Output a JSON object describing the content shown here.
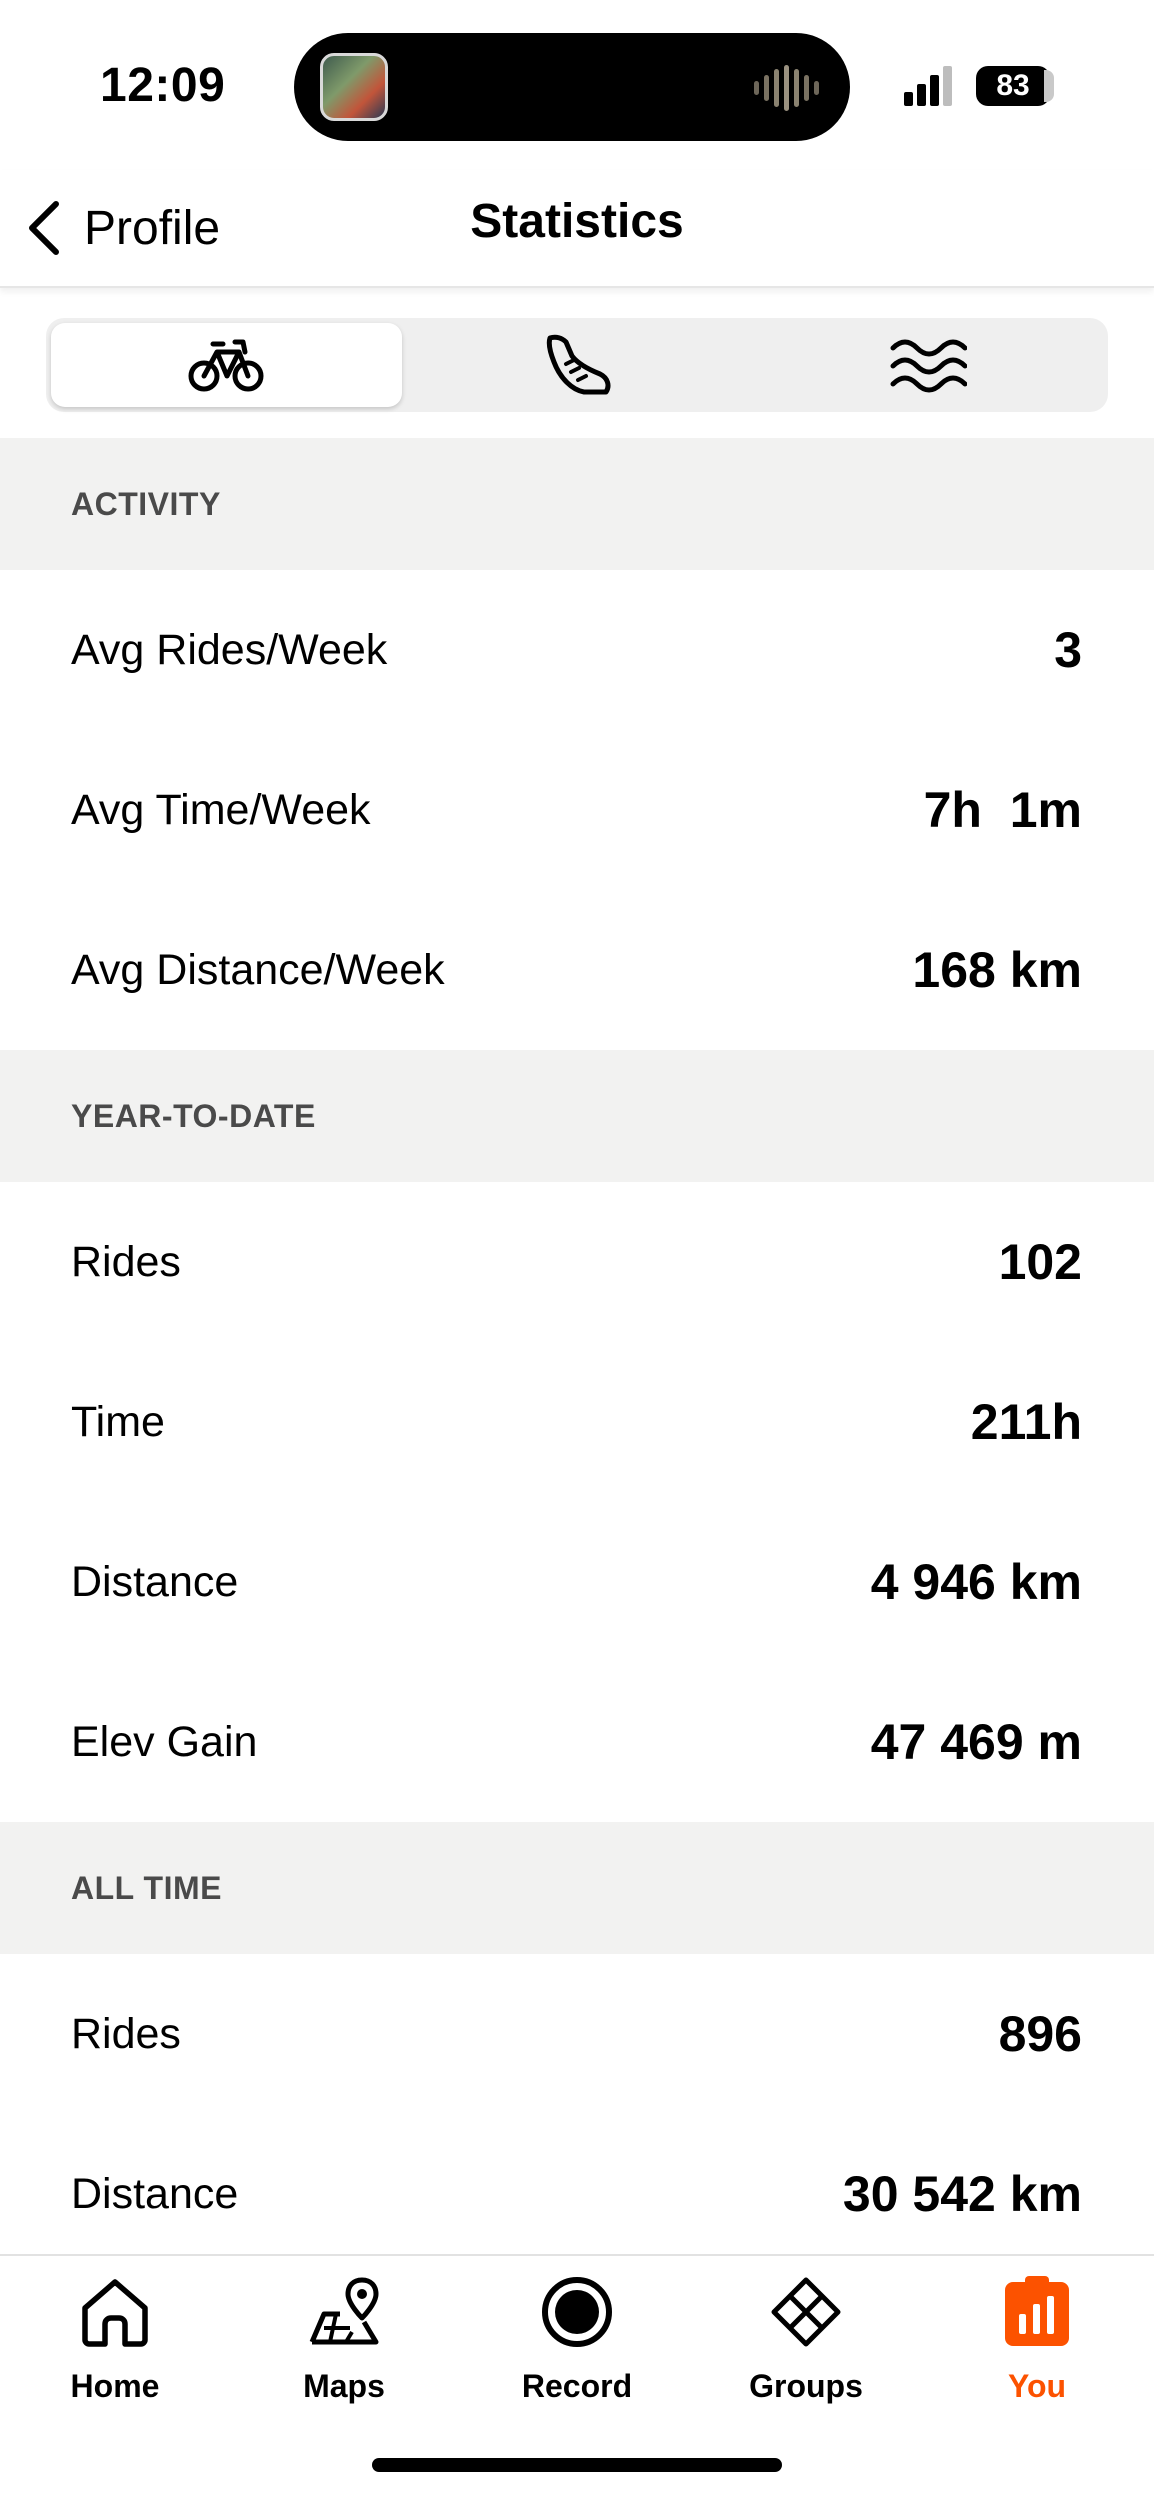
{
  "status_bar": {
    "time": "12:09",
    "battery": "83"
  },
  "header": {
    "back_label": "Profile",
    "title": "Statistics"
  },
  "sport_tabs": [
    {
      "icon": "bike-icon",
      "active": true
    },
    {
      "icon": "run-shoe-icon",
      "active": false
    },
    {
      "icon": "swim-waves-icon",
      "active": false
    }
  ],
  "sections": {
    "activity": {
      "title": "ACTIVITY",
      "rows": [
        {
          "label": "Avg Rides/Week",
          "value": "3"
        },
        {
          "label": "Avg Time/Week",
          "value": "7h  1m"
        },
        {
          "label": "Avg Distance/Week",
          "value": "168 km"
        }
      ]
    },
    "ytd": {
      "title": "YEAR-TO-DATE",
      "rows": [
        {
          "label": "Rides",
          "value": "102"
        },
        {
          "label": "Time",
          "value": "211h"
        },
        {
          "label": "Distance",
          "value": "4 946 km"
        },
        {
          "label": "Elev Gain",
          "value": "47 469 m"
        }
      ]
    },
    "all_time": {
      "title": "ALL TIME",
      "rows": [
        {
          "label": "Rides",
          "value": "896"
        },
        {
          "label": "Distance",
          "value": "30 542 km"
        }
      ]
    }
  },
  "tab_bar": {
    "items": [
      {
        "label": "Home",
        "icon": "home-icon"
      },
      {
        "label": "Maps",
        "icon": "maps-icon"
      },
      {
        "label": "Record",
        "icon": "record-icon"
      },
      {
        "label": "Groups",
        "icon": "groups-icon"
      },
      {
        "label": "You",
        "icon": "you-icon"
      }
    ],
    "active": "You"
  },
  "colors": {
    "accent": "#FC5200",
    "section_bg": "#F2F2F1"
  }
}
